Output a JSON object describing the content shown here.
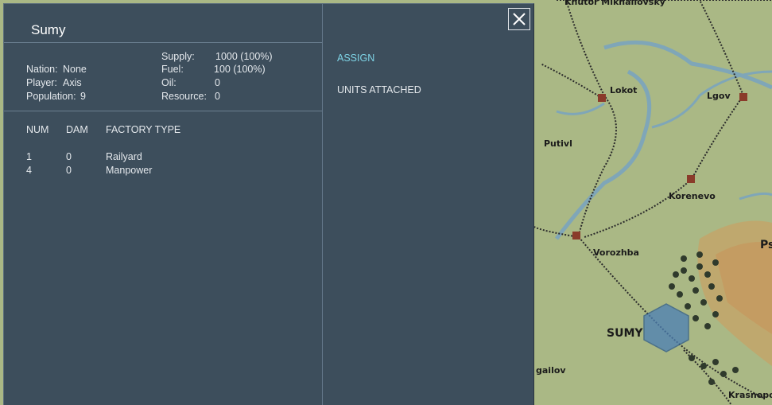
{
  "city": {
    "name": "Sumy"
  },
  "info": {
    "nation_label": "Nation:",
    "nation_value": "None",
    "player_label": "Player:",
    "player_value": "Axis",
    "population_label": "Population:",
    "population_value": "9"
  },
  "resources": {
    "supply_label": "Supply:",
    "supply_value": "1000 (100%)",
    "fuel_label": "Fuel:",
    "fuel_value": "100 (100%)",
    "oil_label": "Oil:",
    "oil_value": "0",
    "resource_label": "Resource:",
    "resource_value": "0"
  },
  "factory_table": {
    "headers": [
      "NUM",
      "DAM",
      "FACTORY TYPE"
    ],
    "rows": [
      {
        "num": "1",
        "dam": "0",
        "type": "Railyard"
      },
      {
        "num": "4",
        "dam": "0",
        "type": "Manpower"
      }
    ]
  },
  "actions": {
    "assign_label": "ASSIGN",
    "units_attached_label": "UNITS ATTACHED"
  },
  "close": {
    "icon": "close-icon"
  },
  "map": {
    "labels": {
      "khutor": "Khutor Mikhailovsky",
      "lokot": "Lokot",
      "lgov": "Lgov",
      "putivl": "Putivl",
      "korenevo": "Korenevo",
      "vorozhba": "Vorozhba",
      "sumy": "SUMY",
      "gailov": "gailov",
      "krasnopo": "Krasnopo",
      "ps": "Ps"
    },
    "colors": {
      "terrain": "#a9b984",
      "river": "#7fa6b8",
      "hex": "#4b7fb5"
    }
  }
}
